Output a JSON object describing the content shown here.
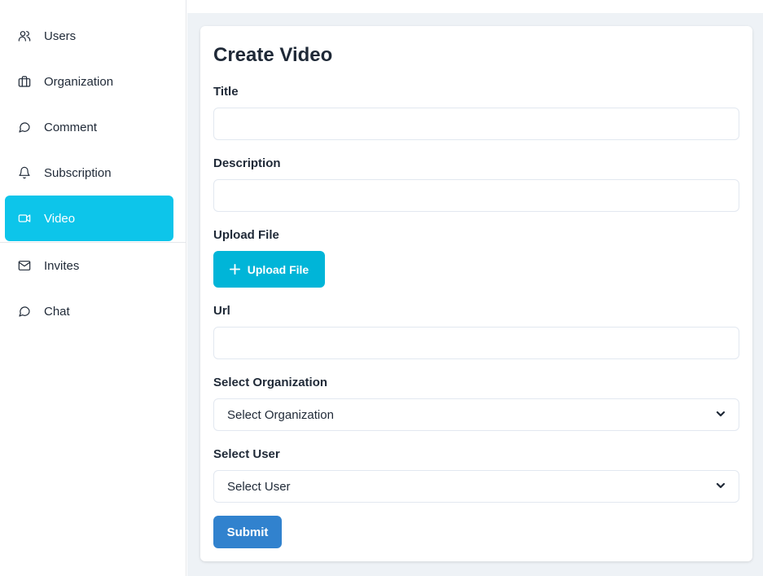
{
  "sidebar": {
    "items": [
      {
        "label": "Users",
        "icon": "users-icon"
      },
      {
        "label": "Organization",
        "icon": "briefcase-icon"
      },
      {
        "label": "Comment",
        "icon": "message-circle-icon"
      },
      {
        "label": "Subscription",
        "icon": "bell-icon"
      },
      {
        "label": "Video",
        "icon": "video-icon",
        "active": true
      },
      {
        "label": "Invites",
        "icon": "mail-icon"
      },
      {
        "label": "Chat",
        "icon": "message-circle-icon"
      }
    ]
  },
  "form": {
    "title": "Create Video",
    "title_label": "Title",
    "title_value": "",
    "description_label": "Description",
    "description_value": "",
    "upload_label": "Upload File",
    "upload_button": "Upload File",
    "url_label": "Url",
    "url_value": "",
    "organization_label": "Select Organization",
    "organization_selected": "Select Organization",
    "user_label": "Select User",
    "user_selected": "Select User",
    "submit_label": "Submit"
  },
  "colors": {
    "active_nav": "#0dc5ea",
    "upload_button": "#00b5d8",
    "submit_button": "#3182ce",
    "main_background": "#eef2f6"
  }
}
